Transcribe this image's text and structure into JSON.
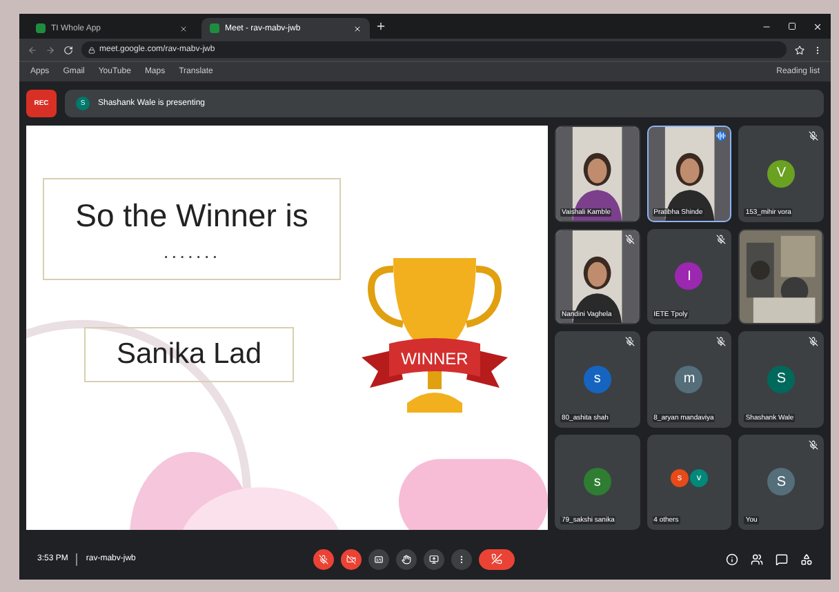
{
  "browser": {
    "tabs": [
      {
        "title": "TI Whole App",
        "selected": false
      },
      {
        "title": "Meet - rav-mabv-jwb",
        "selected": true
      }
    ],
    "url": "meet.google.com/rav-mabv-jwb",
    "bookmarks": [
      "Apps",
      "Gmail",
      "YouTube",
      "Maps",
      "Translate"
    ],
    "reading_list": "Reading list"
  },
  "meeting": {
    "recording_label": "REC",
    "presenter_initial": "S",
    "presenter_banner": "Shashank Wale is presenting",
    "slide": {
      "heading": "So the Winner is",
      "dots": ".......",
      "winner_name": "Sanika Lad",
      "trophy_label": "WINNER"
    },
    "tiles": [
      {
        "kind": "video",
        "name": "Vaishali Kamble",
        "muted": false,
        "speaking": false
      },
      {
        "kind": "video",
        "name": "Pratibha Shinde",
        "muted": false,
        "speaking": true
      },
      {
        "kind": "avatar",
        "name": "153_mihir vora",
        "letter": "V",
        "color": "#6aa121",
        "muted": true,
        "speaking": false
      },
      {
        "kind": "video",
        "name": "Nandini Vaghela",
        "muted": true,
        "speaking": false
      },
      {
        "kind": "avatar",
        "name": "IETE Tpoly",
        "letter": "I",
        "color": "#9c27b0",
        "muted": true,
        "speaking": false
      },
      {
        "kind": "video",
        "muted": false,
        "speaking": false
      },
      {
        "kind": "avatar",
        "name": "80_ashita shah",
        "letter": "s",
        "color": "#1565c0",
        "muted": true,
        "speaking": false
      },
      {
        "kind": "avatar",
        "name": "8_aryan mandaviya",
        "letter": "m",
        "color": "#546e7a",
        "muted": true,
        "speaking": false
      },
      {
        "kind": "avatar",
        "name": "Shashank Wale",
        "letter": "S",
        "color": "#00695c",
        "muted": true,
        "speaking": false
      },
      {
        "kind": "avatar",
        "name": "79_sakshi sanika",
        "letter": "s",
        "color": "#2e7d32",
        "muted": false,
        "speaking": false
      },
      {
        "kind": "others",
        "name": "4 others",
        "letters": [
          {
            "letter": "s",
            "color": "#e64a19"
          },
          {
            "letter": "v",
            "color": "#00897b"
          }
        ],
        "muted": false,
        "speaking": false
      },
      {
        "kind": "avatar",
        "name": "You",
        "letter": "S",
        "color": "#546e7a",
        "muted": true,
        "speaking": false
      }
    ],
    "time": "3:53 PM",
    "code": "rav-mabv-jwb"
  }
}
